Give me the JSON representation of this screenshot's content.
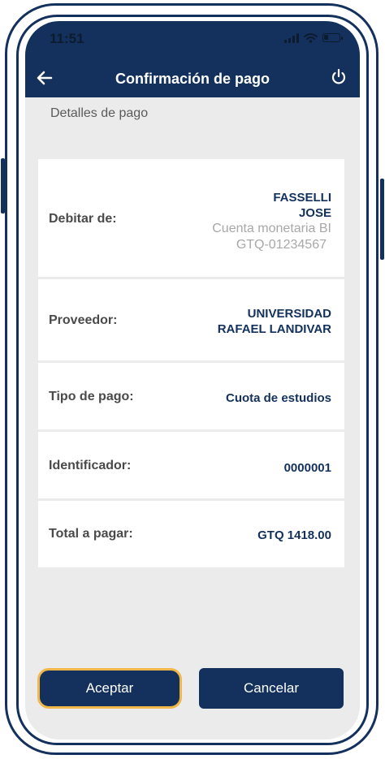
{
  "status_bar": {
    "time": "11:51"
  },
  "header": {
    "title": "Confirmación de pago"
  },
  "section_label": "Detalles de pago",
  "details": {
    "debitar": {
      "label": "Debitar de:",
      "name_line1": "FASSELLI",
      "name_line2": "JOSE",
      "account_type": "Cuenta monetaria BI",
      "account_number": "GTQ-01234567"
    },
    "proveedor": {
      "label": "Proveedor:",
      "line1": "UNIVERSIDAD",
      "line2": "RAFAEL LANDIVAR"
    },
    "tipo_pago": {
      "label": "Tipo de pago:",
      "value": "Cuota de estudios"
    },
    "identificador": {
      "label": "Identificador:",
      "value": "0000001"
    },
    "total": {
      "label": "Total a pagar:",
      "value": "GTQ 1418.00"
    }
  },
  "actions": {
    "accept_label": "Aceptar",
    "cancel_label": "Cancelar"
  },
  "colors": {
    "primary": "#13315c",
    "accent": "#f0b84a",
    "background": "#ebebeb"
  },
  "icons": {
    "back": "arrow-left-icon",
    "power": "power-icon",
    "signal": "signal-icon",
    "wifi": "wifi-icon",
    "battery": "battery-icon"
  },
  "battery_level": 0.3
}
